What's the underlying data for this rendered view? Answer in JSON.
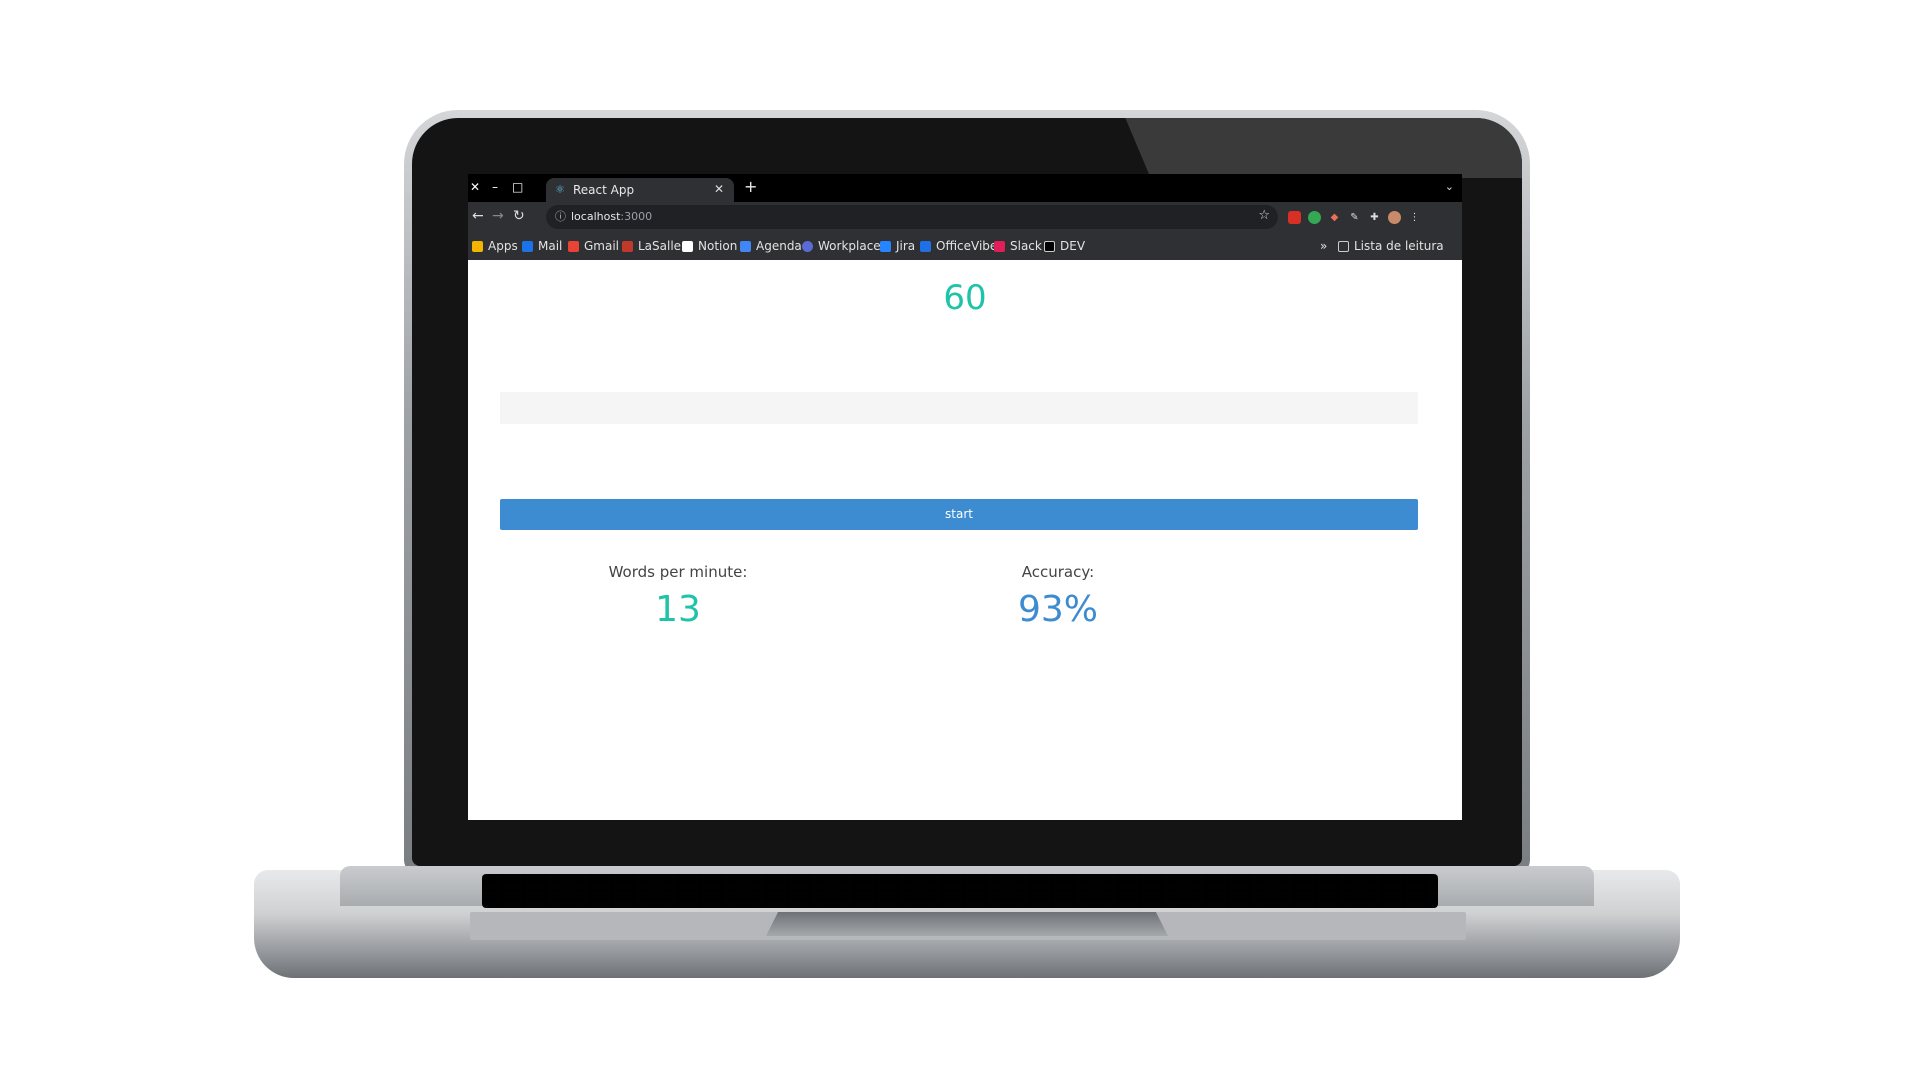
{
  "browser": {
    "window_controls": {
      "close": "✕",
      "minimize": "–",
      "maximize": "□"
    },
    "tab": {
      "title": "React App"
    },
    "new_tab": "+",
    "address": {
      "host": "localhost",
      "port": ":3000"
    },
    "bookmarks": [
      {
        "label": "Apps",
        "icon": "apps-grid-icon",
        "color": "#f4b400"
      },
      {
        "label": "Mail",
        "icon": "mail-icon",
        "color": "#1a73e8"
      },
      {
        "label": "Gmail",
        "icon": "gmail-icon",
        "color": "#ea4335"
      },
      {
        "label": "LaSalle",
        "icon": "lasalle-icon",
        "color": "#c0392b"
      },
      {
        "label": "Notion",
        "icon": "notion-icon",
        "color": "#ffffff"
      },
      {
        "label": "Agenda",
        "icon": "calendar-icon",
        "color": "#4285f4"
      },
      {
        "label": "Workplace",
        "icon": "workplace-icon",
        "color": "#5b6bd4"
      },
      {
        "label": "Jira",
        "icon": "jira-icon",
        "color": "#2684ff"
      },
      {
        "label": "OfficeVibe",
        "icon": "officevibe-icon",
        "color": "#1f6fe5"
      },
      {
        "label": "Slack",
        "icon": "slack-icon",
        "color": "#e01e5a"
      },
      {
        "label": "DEV",
        "icon": "dev-icon",
        "color": "#000000"
      }
    ],
    "bookmarks_overflow": "»",
    "reading_list": "Lista de leitura"
  },
  "app": {
    "timer": "60",
    "start_label": "start",
    "wpm_label": "Words per minute:",
    "wpm_value": "13",
    "accuracy_label": "Accuracy:",
    "accuracy_value": "93%",
    "colors": {
      "teal": "#1ec3a8",
      "blue": "#3d8bd0"
    }
  }
}
